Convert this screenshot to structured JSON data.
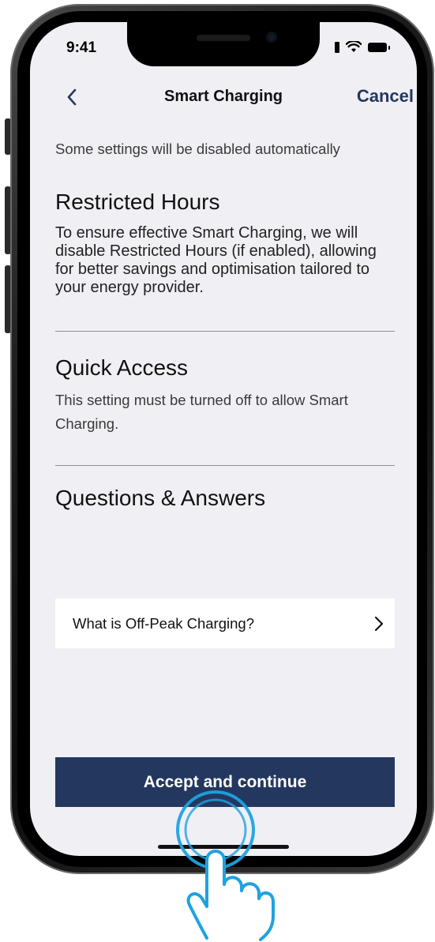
{
  "status_bar": {
    "time": "9:41"
  },
  "nav": {
    "title": "Smart Charging",
    "cancel_label": "Cancel",
    "back_icon": "chevron-left-icon"
  },
  "intro_text": "Some settings will be disabled automatically",
  "sections": [
    {
      "title": "Restricted Hours",
      "text": "To ensure effective Smart Charging, we will disable Restricted Hours (if enabled), allowing for better savings and optimisation tailored to your energy provider."
    },
    {
      "title": "Quick Access",
      "text": "This setting must be turned off to allow Smart Charging."
    },
    {
      "title": "Questions & Answers"
    }
  ],
  "qa_items": [
    {
      "label": "What is Off-Peak Charging?",
      "icon": "chevron-right-icon"
    }
  ],
  "cta": {
    "label": "Accept and continue"
  },
  "colors": {
    "accent": "#24385f",
    "background": "#f0eff4",
    "tap_hint": "#1fa2e0"
  }
}
